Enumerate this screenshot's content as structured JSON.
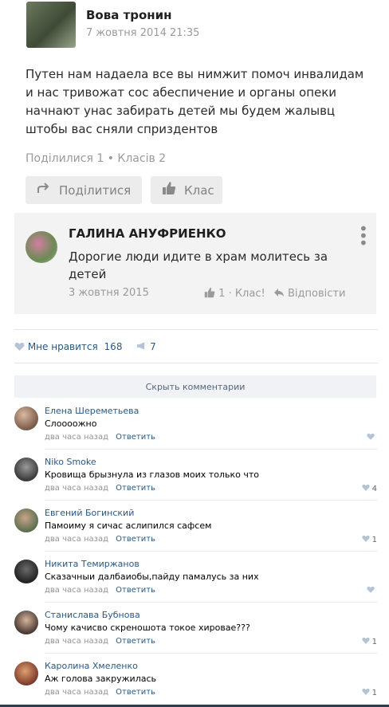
{
  "post": {
    "author": "Вова тронин",
    "date": "7 жовтня 2014 21:35",
    "text": "Путен нам надаела все вы нимжит помоч инвалидам и нас тривожат сос абеспичение и органы опеки начнают унас забирать детей мы будем жалывц штобы вас сняли сприздентов",
    "shared": "Поділилися 1",
    "dot": "•",
    "classes": "Класів 2",
    "share_label": "Поділитися",
    "class_label": "Клас"
  },
  "reply": {
    "author": "ГАЛИНА АНУФРИЕНКО",
    "text": "Дорогие люди идите в храм молитесь за детей",
    "date": "3 жовтня 2015",
    "likes": "1",
    "class_label": "· Клас!",
    "answer_label": "Відповісти"
  },
  "stats": {
    "likes_label": "Мне нравится",
    "likes_count": "168",
    "reposts_count": "7"
  },
  "hide_comments_label": "Скрыть комментарии",
  "comments": [
    {
      "name": "Елена Шереметьева",
      "text": "Слоооожно",
      "time": "два часа назад",
      "reply": "Ответить",
      "likes": ""
    },
    {
      "name": "Niko Smoke",
      "text": "Кровища брызнула из глазов моих только что",
      "time": "два часа назад",
      "reply": "Ответить",
      "likes": "4"
    },
    {
      "name": "Евгений Богинский",
      "text": "Памоиму я сичас аслипился сафсем",
      "time": "два часа назад",
      "reply": "Ответить",
      "likes": "1"
    },
    {
      "name": "Никита Темиржанов",
      "text": "Сказачныи далбаиобы,пайду памалусь за них",
      "time": "два часа назад",
      "reply": "Ответить",
      "likes": ""
    },
    {
      "name": "Станислава Бубнова",
      "text": "Чому качисво скреношота токое хировае???",
      "time": "два часа назад",
      "reply": "Ответить",
      "likes": "1"
    },
    {
      "name": "Каролина Хмеленко",
      "text": "Аж голова закружилась",
      "time": "два часа назад",
      "reply": "Ответить",
      "likes": "1"
    }
  ],
  "icons": {
    "share": "share-icon",
    "class": "thumb-icon",
    "menu": "more-vertical-icon",
    "heart": "heart-icon",
    "repost": "megaphone-icon",
    "reply": "reply-arrow-icon"
  },
  "colors": {
    "link": "#2a5885",
    "muted": "#9a9a9a",
    "card_bg": "#f3f3f3"
  }
}
